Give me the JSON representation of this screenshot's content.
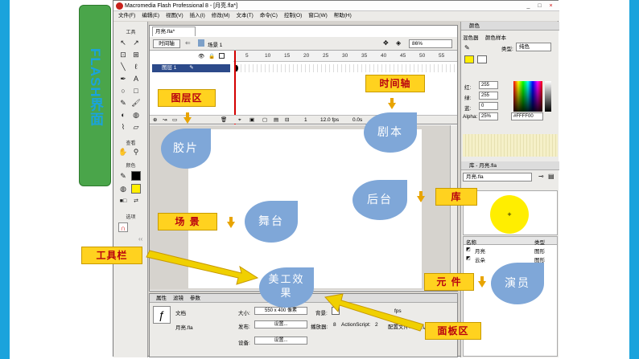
{
  "side_title": "FLASH界面",
  "window": {
    "title": "Macromedia Flash Professional 8 - [月亮.fla*]",
    "controls": [
      "_",
      "□",
      "×"
    ]
  },
  "menu": [
    "文件(F)",
    "编辑(E)",
    "视图(V)",
    "插入(I)",
    "修改(M)",
    "文本(T)",
    "命令(C)",
    "控制(O)",
    "窗口(W)",
    "帮助(H)"
  ],
  "toolbar": {
    "header_tools": "工具",
    "header_view": "查看",
    "header_colors": "颜色",
    "header_options": "选项"
  },
  "document": {
    "tab": "月亮.fla*",
    "timeline_button": "时间轴",
    "scene": "场景 1",
    "zoom": "86%"
  },
  "timeline": {
    "layer_name": "图层 1",
    "ruler_ticks": [
      "5",
      "10",
      "15",
      "20",
      "25",
      "30",
      "35",
      "40",
      "45",
      "50",
      "55"
    ],
    "current_frame": "1",
    "fps": "12.0 fps",
    "time": "0.0s"
  },
  "properties": {
    "tabs": [
      "属性",
      "滤镜",
      "参数"
    ],
    "doc_label": "文档",
    "doc_name": "月亮.fla",
    "size_label": "大小:",
    "size_value": "550 x 400 像素",
    "bg_label": "背景:",
    "publish_label": "发布:",
    "settings_button": "设置...",
    "player_label": "播放器:",
    "player_value": "8",
    "actionscript_label": "ActionScript:",
    "actionscript_value": "2",
    "profile_label": "配置文件:",
    "profile_value": "默认",
    "device_label": "设备:",
    "fps_label": "fps"
  },
  "color_panel": {
    "title": "颜色",
    "tab_mixer": "混色器",
    "tab_swatches": "颜色样本",
    "type_label": "类型:",
    "type_value": "纯色",
    "red_label": "红:",
    "red_value": "255",
    "green_label": "绿:",
    "green_value": "255",
    "blue_label": "蓝:",
    "blue_value": "0",
    "alpha_label": "Alpha:",
    "alpha_value": "25%",
    "hex_value": "#FFFF00"
  },
  "library": {
    "title": "库 - 月亮.fla",
    "file": "月亮.fla",
    "col_name": "名称",
    "col_type": "类型",
    "items": [
      {
        "name": "月亮",
        "type": "图形"
      },
      {
        "name": "云朵",
        "type": "图形"
      }
    ]
  },
  "annotations": {
    "leaf_film": "胶片",
    "leaf_script": "剧本",
    "leaf_backstage": "后台",
    "leaf_stage": "舞台",
    "leaf_effects": "美工效果",
    "leaf_actor": "演员",
    "note_layers": "图层区",
    "note_timeline": "时间轴",
    "note_library": "库",
    "note_scene": "场 景",
    "note_toolbar": "工具栏",
    "note_element": "元 件",
    "note_panels": "面板区"
  },
  "colors": {
    "accent_blue": "#1aa3dc",
    "green_bar": "#4aa54a",
    "note_yellow": "#ffd21f",
    "leaf_blue": "#7fa7d8",
    "arrow": "#f0d000"
  }
}
